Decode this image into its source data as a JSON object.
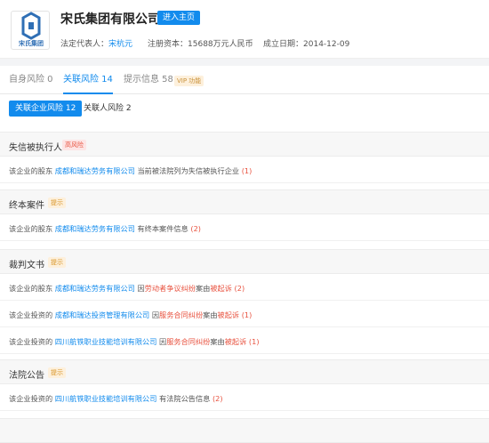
{
  "header": {
    "logo_text": "宋氏集团",
    "company_name": "宋氏集团有限公司",
    "home_button": "进入主页",
    "legal_rep_label": "法定代表人：",
    "legal_rep_name": "宋杭元",
    "capital_label": "注册资本：",
    "capital_value": "15688万元人民币",
    "founded_label": "成立日期：",
    "founded_value": "2014-12-09"
  },
  "tabs": [
    {
      "label": "自身风险 0"
    },
    {
      "label": "关联风险 14"
    },
    {
      "label": "提示信息 58"
    }
  ],
  "vip_badge": "VIP 功能",
  "subtabs": {
    "active": "关联企业风险 12",
    "other": "关联人风险 2"
  },
  "sections": [
    {
      "title": "失信被执行人",
      "tag": "高风险",
      "rows": [
        {
          "pre": "该企业的股东",
          "link": "成都和瑞达劳务有限公司",
          "mid": "当前被法院列为失信被执行企业",
          "reason": "",
          "mid2": "",
          "status": "",
          "count": "(1)"
        }
      ]
    },
    {
      "title": "终本案件",
      "tag": "提示",
      "rows": [
        {
          "pre": "该企业的股东",
          "link": "成都和瑞达劳务有限公司",
          "mid": "有终本案件信息",
          "reason": "",
          "mid2": "",
          "status": "",
          "count": "(2)"
        }
      ]
    },
    {
      "title": "裁判文书",
      "tag": "提示",
      "rows": [
        {
          "pre": "该企业的股东",
          "link": "成都和瑞达劳务有限公司",
          "mid": "因",
          "reason": "劳动者争议纠纷",
          "mid2": "案由",
          "status": "被起诉",
          "count": "(2)"
        },
        {
          "pre": "该企业投资的",
          "link": "成都和瑞达投资管理有限公司",
          "mid": "因",
          "reason": "服务合同纠纷",
          "mid2": "案由",
          "status": "被起诉",
          "count": "(1)"
        },
        {
          "pre": "该企业投资的",
          "link": "四川航铁职业技能培训有限公司",
          "mid": "因",
          "reason": "服务合同纠纷",
          "mid2": "案由",
          "status": "被起诉",
          "count": "(1)"
        }
      ]
    },
    {
      "title": "法院公告",
      "tag": "提示",
      "rows": [
        {
          "pre": "该企业投资的",
          "link": "四川航铁职业技能培训有限公司",
          "mid": "有法院公告信息",
          "reason": "",
          "mid2": "",
          "status": "",
          "count": "(2)"
        }
      ]
    }
  ],
  "colors": {
    "accent": "#128bed",
    "risk_red": "#e8523f",
    "hint_orange": "#d9962a"
  }
}
